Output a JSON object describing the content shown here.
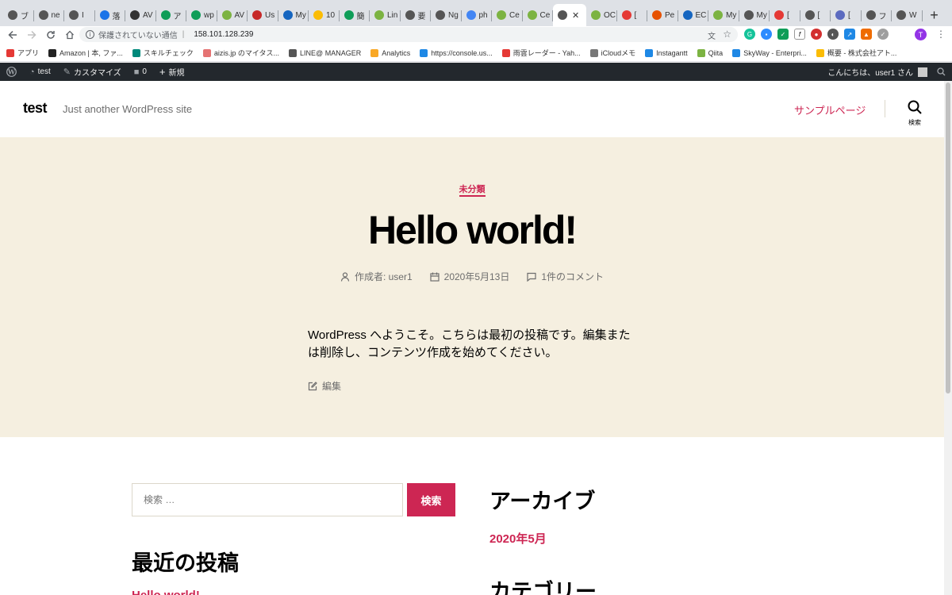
{
  "tabs": [
    {
      "label": "ブ",
      "color": "#555"
    },
    {
      "label": "ne",
      "color": "#555"
    },
    {
      "label": "I",
      "color": "#555"
    },
    {
      "label": "落",
      "color": "#1a73e8"
    },
    {
      "label": "AV",
      "color": "#333"
    },
    {
      "label": "ア",
      "color": "#0f9d58"
    },
    {
      "label": "wp",
      "color": "#0f9d58"
    },
    {
      "label": "AV",
      "color": "#7cb342"
    },
    {
      "label": "Us",
      "color": "#c62828"
    },
    {
      "label": "My",
      "color": "#1565c0"
    },
    {
      "label": "10",
      "color": "#fbbc04"
    },
    {
      "label": "簡",
      "color": "#0f9d58"
    },
    {
      "label": "Lin",
      "color": "#7cb342"
    },
    {
      "label": "要",
      "color": "#555"
    },
    {
      "label": "Ng",
      "color": "#555"
    },
    {
      "label": "ph",
      "color": "#4285f4"
    },
    {
      "label": "Ce",
      "color": "#7cb342"
    },
    {
      "label": "Ce",
      "color": "#7cb342"
    },
    {
      "label": "",
      "color": "#555",
      "active": true
    },
    {
      "label": "OC",
      "color": "#7cb342"
    },
    {
      "label": "[",
      "color": "#e53935"
    },
    {
      "label": "Pe",
      "color": "#e65100"
    },
    {
      "label": "EC",
      "color": "#1565c0"
    },
    {
      "label": "My",
      "color": "#7cb342"
    },
    {
      "label": "My",
      "color": "#555"
    },
    {
      "label": "[",
      "color": "#e53935"
    },
    {
      "label": "[",
      "color": "#555"
    },
    {
      "label": "[",
      "color": "#5c6bc0"
    },
    {
      "label": "フ",
      "color": "#555"
    },
    {
      "label": "W",
      "color": "#555"
    }
  ],
  "toolbar": {
    "security_text": "保護されていない通信",
    "url": "158.101.128.239"
  },
  "bookmarks": [
    {
      "label": "アプリ",
      "color": "#e53935"
    },
    {
      "label": "Amazon | 本, ファ...",
      "color": "#222"
    },
    {
      "label": "スキルチェック",
      "color": "#00897b"
    },
    {
      "label": "aizis.jp のマイタス...",
      "color": "#e57373"
    },
    {
      "label": "LINE@ MANAGER",
      "color": "#555"
    },
    {
      "label": "Analytics",
      "color": "#f9a825"
    },
    {
      "label": "https://console.us...",
      "color": "#1e88e5"
    },
    {
      "label": "雨雲レーダー - Yah...",
      "color": "#e53935"
    },
    {
      "label": "iCloudメモ",
      "color": "#777"
    },
    {
      "label": "Instagantt",
      "color": "#1e88e5"
    },
    {
      "label": "Qiita",
      "color": "#7cb342"
    },
    {
      "label": "SkyWay - Enterpri...",
      "color": "#1e88e5"
    },
    {
      "label": "概要 - 株式会社アト...",
      "color": "#fbbc04"
    }
  ],
  "adminbar": {
    "site": "test",
    "customize": "カスタマイズ",
    "comments": "0",
    "new": "新規",
    "greeting": "こんにちは、user1 さん"
  },
  "header": {
    "site_title": "test",
    "site_desc": "Just another WordPress site",
    "nav_item": "サンプルページ",
    "search_label": "検索"
  },
  "post": {
    "category": "未分類",
    "title": "Hello world!",
    "author": "作成者: user1",
    "date": "2020年5月13日",
    "comments": "1件のコメント",
    "content": "WordPress へようこそ。こちらは最初の投稿です。編集または削除し、コンテンツ作成を始めてください。",
    "edit": "編集"
  },
  "widgets": {
    "search_placeholder": "検索 …",
    "search_button": "検索",
    "recent_title": "最近の投稿",
    "recent_first": "Hello world!",
    "archive_title": "アーカイブ",
    "archive_item": "2020年5月",
    "category_title": "カテゴリー"
  },
  "colors": {
    "accent": "#cd2653",
    "hero_bg": "#f5efe0",
    "adminbar_bg": "#23282d"
  }
}
